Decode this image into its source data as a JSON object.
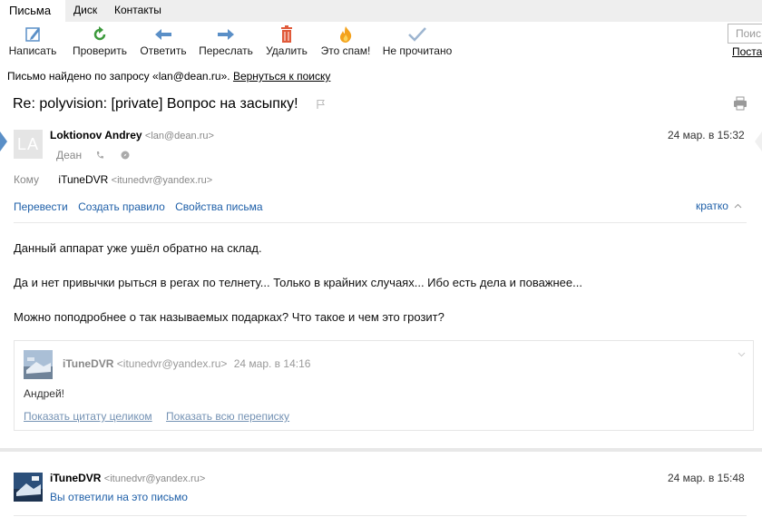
{
  "nav": {
    "tabs": [
      "Письма",
      "Диск",
      "Контакты"
    ]
  },
  "toolbar": {
    "compose": "Написать",
    "check": "Проверить",
    "reply": "Ответить",
    "forward": "Переслать",
    "delete": "Удалить",
    "spam": "Это спам!",
    "unread": "Не прочитано"
  },
  "search": {
    "placeholder": "Поис",
    "link": "Поста"
  },
  "found": {
    "prefix": "Письмо найдено по запросу «lan@dean.ru».",
    "back": "Вернуться к поиску"
  },
  "subject": "Re: polyvision: [private] Вопрос на засыпку!",
  "message": {
    "avatar_initials": "LA",
    "sender_name": "Loktionov Andrey",
    "sender_email": "<lan@dean.ru>",
    "date": "24 мар. в 15:32",
    "org": "Деан",
    "to_label": "Кому",
    "to_name": "iTuneDVR",
    "to_email": "<itunedvr@yandex.ru>",
    "actions": [
      "Перевести",
      "Создать правило",
      "Свойства письма"
    ],
    "brief": "кратко",
    "body": [
      "Данный аппарат уже ушёл обратно на склад.",
      "Да и нет привычки рыться в регах по телнету... Только в крайних случаях... Ибо есть дела и поважнее...",
      "Можно поподробнее о так называемых подарках? Что такое и чем это грозит?"
    ],
    "quote": {
      "sender_name": "iTuneDVR",
      "sender_email": "<itunedvr@yandex.ru>",
      "date": "24 мар. в 14:16",
      "text": "Андрей!",
      "show_quote": "Показать цитату целиком",
      "show_thread": "Показать всю переписку"
    }
  },
  "message2": {
    "sender_name": "iTuneDVR",
    "sender_email": "<itunedvr@yandex.ru>",
    "date": "24 мар. в 15:48",
    "status": "Вы ответили на это письмо"
  }
}
